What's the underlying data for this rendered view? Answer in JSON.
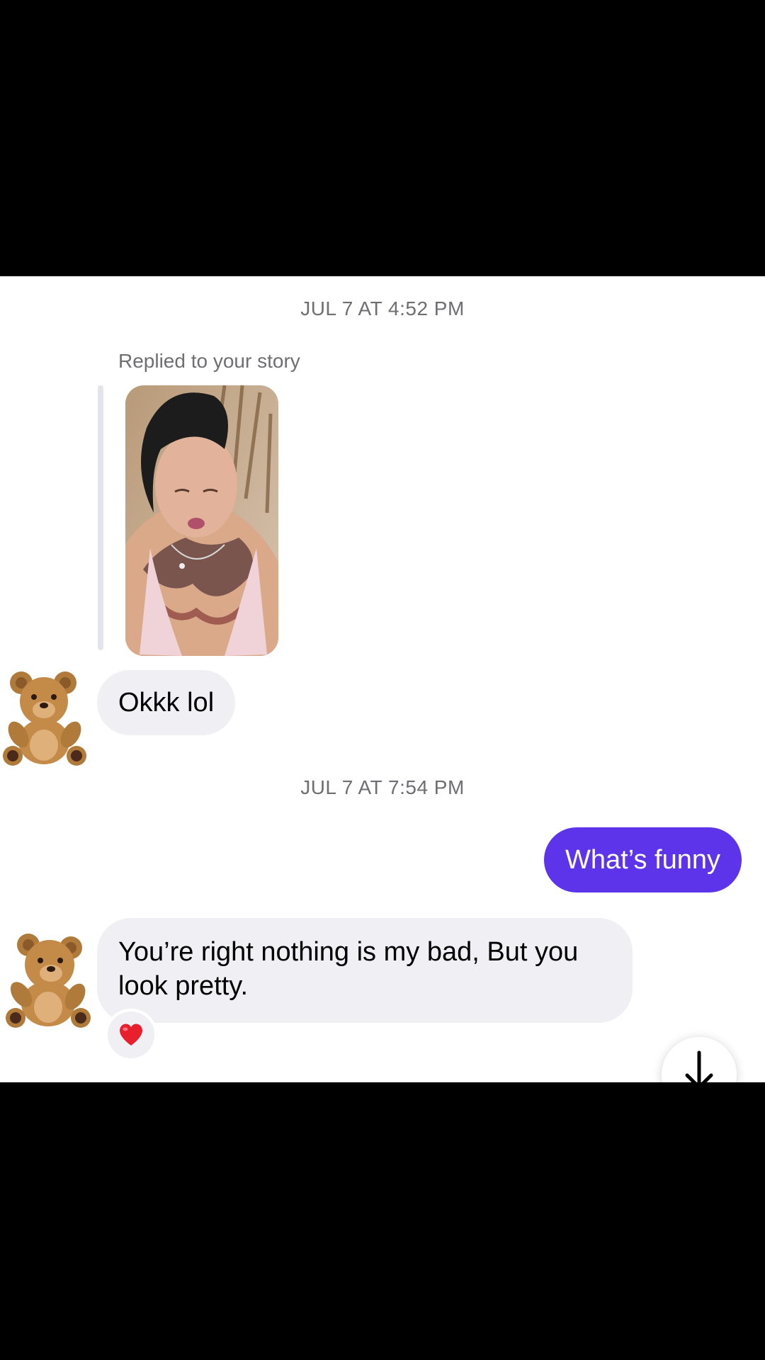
{
  "thread": {
    "timestamps": [
      "JUL 7 AT 4:52 PM",
      "JUL 7 AT 7:54 PM"
    ],
    "story_reply_label": "Replied to your story",
    "messages": [
      {
        "from": "them",
        "text": "Okkk lol"
      },
      {
        "from": "me",
        "text": "What’s funny"
      },
      {
        "from": "them",
        "text": "You’re right nothing is my bad, But you look pretty.",
        "reaction": "heart-icon"
      }
    ]
  },
  "colors": {
    "outgoing_bubble": "#5e34eb",
    "incoming_bubble": "#efeff4",
    "timestamp_text": "#6e6e73"
  },
  "icons": {
    "avatar": "teddy-bear-icon",
    "reaction": "heart-icon",
    "scroll": "arrow-down-icon"
  }
}
